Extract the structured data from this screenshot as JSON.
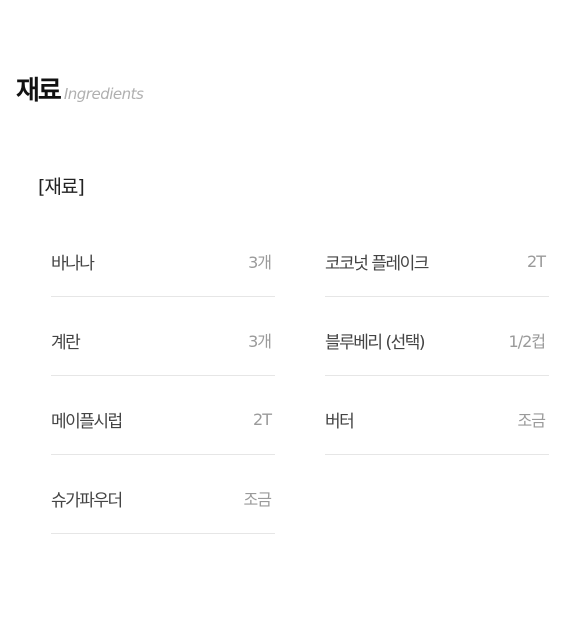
{
  "section": {
    "title_ko": "재료",
    "title_en": "Ingredients"
  },
  "group": {
    "label": "[재료]"
  },
  "columns": [
    [
      {
        "name": "바나나",
        "amount": "3개"
      },
      {
        "name": "계란",
        "amount": "3개"
      },
      {
        "name": "메이플시럽",
        "amount": "2T"
      },
      {
        "name": "슈가파우더",
        "amount": "조금"
      }
    ],
    [
      {
        "name": "코코넛 플레이크",
        "amount": "2T"
      },
      {
        "name": "블루베리 (선택)",
        "amount": "1/2컵"
      },
      {
        "name": "버터",
        "amount": "조금"
      }
    ]
  ]
}
